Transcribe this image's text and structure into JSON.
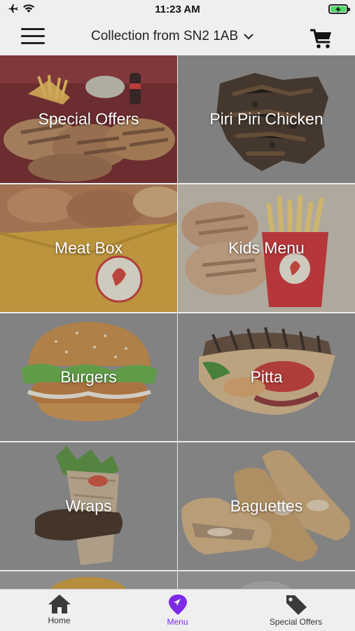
{
  "status_bar": {
    "time": "11:23 AM"
  },
  "header": {
    "collection_label": "Collection from SN2 1AB"
  },
  "menu_tiles": [
    {
      "label": "Special Offers"
    },
    {
      "label": "Piri Piri Chicken"
    },
    {
      "label": "Meat Box"
    },
    {
      "label": "Kids Menu"
    },
    {
      "label": "Burgers"
    },
    {
      "label": "Pitta"
    },
    {
      "label": "Wraps"
    },
    {
      "label": "Baguettes"
    }
  ],
  "tabbar": {
    "tabs": [
      {
        "label": "Home",
        "icon": "home-icon"
      },
      {
        "label": "Menu",
        "icon": "location-pin-icon",
        "active": true
      },
      {
        "label": "Special Offers",
        "icon": "tag-icon"
      }
    ]
  },
  "colors": {
    "accent": "#7d2ae8",
    "battery": "#4cd964",
    "tile_shade": "#8a8a8a"
  }
}
